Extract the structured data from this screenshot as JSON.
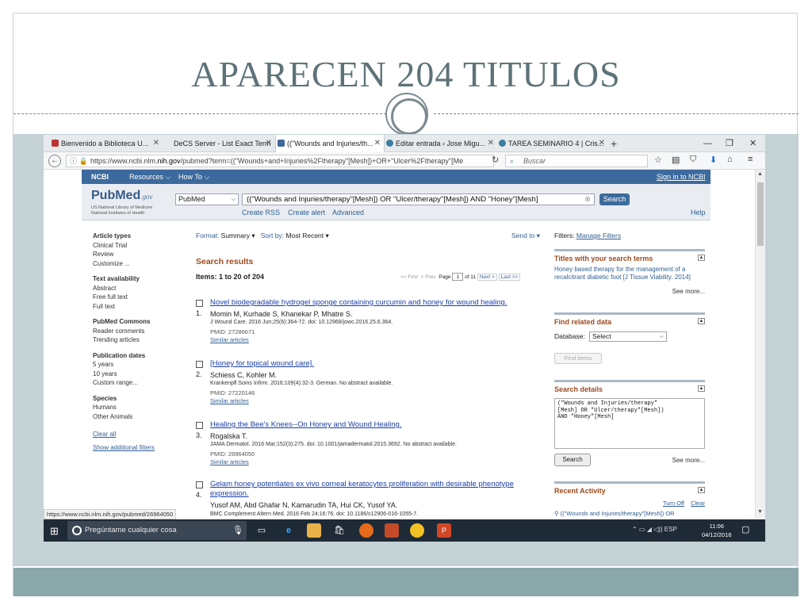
{
  "slide": {
    "title": "APARECEN 204 TITULOS",
    "colors": {
      "title": "#5d7278",
      "band": "#c4d2d6",
      "bottom_bar": "#8aa7a9"
    }
  },
  "browser": {
    "tabs": [
      {
        "label": "Bienvenido a Biblioteca U...",
        "active": false
      },
      {
        "label": "DeCS Server - List Exact Term",
        "active": false
      },
      {
        "label": "((\"Wounds and Injuries/th...",
        "active": true
      },
      {
        "label": "Editar entrada ‹ Jose Migu...",
        "active": false
      },
      {
        "label": "TAREA SEMINARIO 4 | Cris...",
        "active": false
      }
    ],
    "new_tab": "+",
    "url_prefix": "https://www.ncbi.nlm.",
    "url_domain": "nih.gov",
    "url_rest": "/pubmed?term=((\"Wounds+and+Injuries%2Ftherapy\"[Mesh])+OR+\"Ulcer%2Ftherapy\"[Me",
    "search_placeholder": "Buscar",
    "status_url": "https://www.ncbi.nlm.nih.gov/pubmed/26964050"
  },
  "ncbi": {
    "logo": "NCBI",
    "resources": "Resources ⌵",
    "howto": "How To ⌵",
    "signin": "Sign in to NCBI"
  },
  "pubmed": {
    "logo": "PubMed",
    "logo_suffix": ".gov",
    "sub1": "US National Library of Medicine",
    "sub2": "National Institutes of Health",
    "db": "PubMed",
    "query": "((\"Wounds and Injuries/therapy\"[Mesh]) OR \"Ulcer/therapy\"[Mesh]) AND \"Honey\"[Mesh]",
    "search_btn": "Search",
    "links": [
      "Create RSS",
      "Create alert",
      "Advanced"
    ],
    "help": "Help"
  },
  "filters": {
    "article_types": {
      "heading": "Article types",
      "items": [
        "Clinical Trial",
        "Review",
        "Customize ..."
      ]
    },
    "text_availability": {
      "heading": "Text availability",
      "items": [
        "Abstract",
        "Free full text",
        "Full text"
      ]
    },
    "commons": {
      "heading": "PubMed Commons",
      "items": [
        "Reader comments",
        "Trending articles"
      ]
    },
    "pub_dates": {
      "heading": "Publication dates",
      "items": [
        "5 years",
        "10 years",
        "Custom range..."
      ]
    },
    "species": {
      "heading": "Species",
      "items": [
        "Humans",
        "Other Animals"
      ]
    },
    "clear_all": "Clear all",
    "show_additional": "Show additional filters"
  },
  "results": {
    "format_label": "Format:",
    "format_value": "Summary ▾",
    "sort_label": "Sort by:",
    "sort_value": "Most Recent ▾",
    "send_to": "Send to ▾",
    "heading": "Search results",
    "items_label": "Items: 1 to 20 of 204",
    "pager": {
      "first": "<< First",
      "prev": "< Prev",
      "page_label": "Page",
      "page": "1",
      "of": "of 11",
      "next": "Next >",
      "last": "Last >>"
    },
    "list": [
      {
        "num": "1.",
        "title": "Novel biodegradable hydrogel sponge containing curcumin and honey for wound healing.",
        "authors": "Momin M, Kurhade S, Khanekar P, Mhatre S.",
        "journal": "J Wound Care. 2016 Jun;25(6):364-72. doi: 10.12968/jowc.2016.25.6.364.",
        "pmid": "PMID: 27286671",
        "similar": "Similar articles"
      },
      {
        "num": "2.",
        "title": "[Honey for topical wound care].",
        "authors": "Schiess C, Kohler M.",
        "journal": "Krankenpfl Soins Infirm. 2016;109(4):32-3. German. No abstract available.",
        "pmid": "PMID: 27220146",
        "similar": "Similar articles"
      },
      {
        "num": "3.",
        "title": "Healing the Bee's Knees--On Honey and Wound Healing.",
        "authors": "Rogalska T.",
        "journal": "JAMA Dermatol. 2016 Mar;152(3):275. doi: 10.1001/jamadermatol.2015.3692. No abstract available.",
        "pmid": "PMID: 26964050",
        "similar": "Similar articles"
      },
      {
        "num": "4.",
        "title": "Gelam honey potentiates ex vivo corneal keratocytes proliferation with desirable phenotype",
        "title2": "expression.",
        "authors": "Yusof AM, Abd Ghafar N, Kamarudin TA, Hui CK, Yusof YA.",
        "journal": "BMC Complement Altern Med. 2016 Feb 24;16:76. doi: 10.1186/s12906-016-1055-7."
      }
    ]
  },
  "sidebar": {
    "filters_label": "Filters:",
    "manage_filters": "Manage Filters",
    "titles_heading": "Titles with your search terms",
    "titles_text": "Honey based therapy for the management of a recalcitrant diabetic foot [J Tissue Viability. 2014]",
    "see_more": "See more...",
    "related_heading": "Find related data",
    "database_label": "Database:",
    "database_value": "Select",
    "find_items": "Find items",
    "details_heading": "Search details",
    "details_text": "(\"Wounds and Injuries/therapy\"\n[Mesh] OR \"Ulcer/therapy\"[Mesh])\nAND \"Honey\"[Mesh]",
    "details_btn": "Search",
    "recent_heading": "Recent Activity",
    "turn_off": "Turn Off",
    "clear": "Clear",
    "recent_item": "((\"Wounds and Injuries/therapy\"[Mesh]) OR"
  },
  "taskbar": {
    "cortana": "Pregúntame cualquier cosa",
    "lang": "ESP",
    "time": "11:06",
    "date": "04/12/2016"
  }
}
